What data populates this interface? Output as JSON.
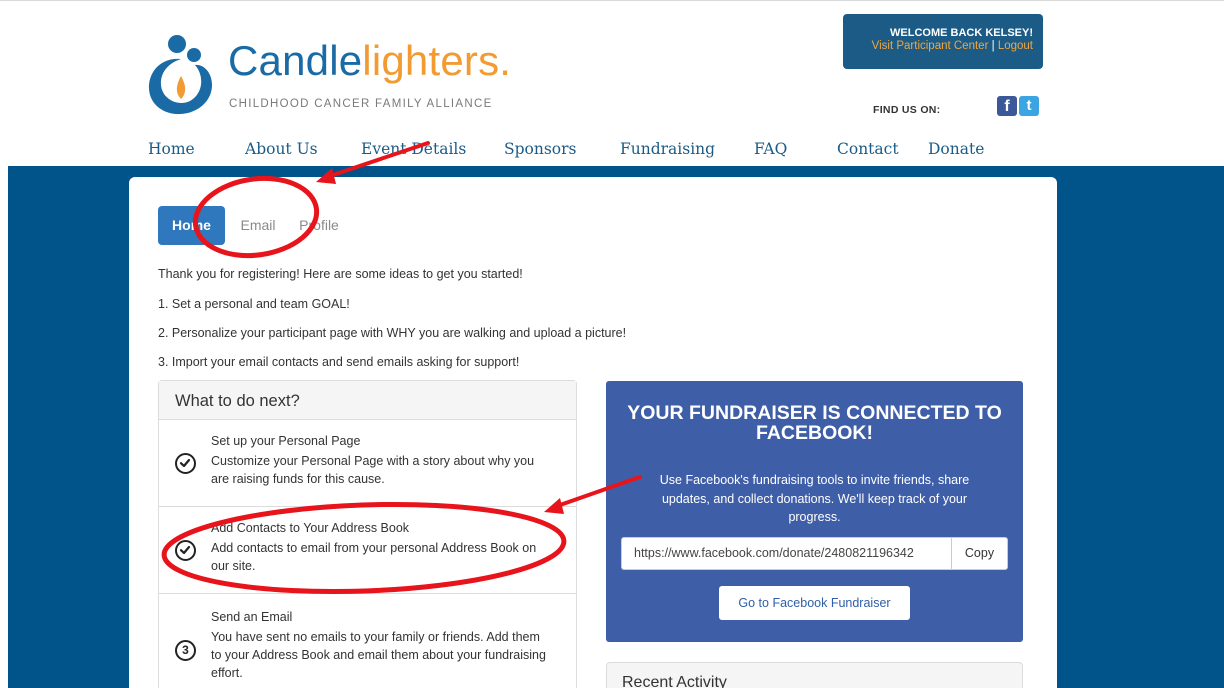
{
  "header": {
    "logo": {
      "word_part1": "Candle",
      "word_part2": "lighters",
      "tagline": "CHILDHOOD CANCER FAMILY ALLIANCE"
    },
    "welcome": {
      "title": "WELCOME BACK KELSEY!",
      "participant_center": "Visit Participant Center",
      "separator": "|",
      "logout": "Logout"
    },
    "find_us": "FIND US ON:",
    "social": {
      "facebook_glyph": "f",
      "twitter_glyph": "t"
    },
    "nav": [
      "Home",
      "About Us",
      "Event Details",
      "Sponsors",
      "Fundraising",
      "FAQ",
      "Contact",
      "Donate"
    ]
  },
  "tabs": [
    "Home",
    "Email",
    "Profile"
  ],
  "intro_lines": [
    "Thank you for registering! Here are some ideas to get you started!",
    "1. Set a personal and team GOAL!",
    "2. Personalize your participant page with WHY you are walking and upload a picture!",
    "3. Import your email contacts and send emails asking for support!"
  ],
  "todo": {
    "title": "What to do next?",
    "steps": [
      {
        "title": "Set up your Personal Page",
        "desc": "Customize your Personal Page with a story about why you are raising funds for this cause.",
        "icon": "check-circle-icon"
      },
      {
        "title": "Add Contacts to Your Address Book",
        "desc": "Add contacts to email from your personal Address Book on our site.",
        "icon": "check-circle-icon"
      },
      {
        "title": "Send an Email",
        "desc": "You have sent no emails to your family or friends. Add them to your Address Book and email them about your fundraising effort.",
        "icon_text": "3"
      }
    ]
  },
  "facebook": {
    "title": "YOUR FUNDRAISER IS CONNECTED TO FACEBOOK!",
    "desc": "Use Facebook's fundraising tools to invite friends, share updates, and collect donations. We'll keep track of your progress.",
    "url": "https://www.facebook.com/donate/2480821196342",
    "copy_label": "Copy",
    "go_label": "Go to Facebook Fundraiser"
  },
  "recent": {
    "title": "Recent Activity"
  },
  "colors": {
    "brand_blue": "#1b5b86",
    "band_blue": "#00548a",
    "brand_orange": "#f29b33",
    "tab_active": "#2f78bd",
    "facebook_panel": "#3f5ea8",
    "annotation_red": "#e8141b"
  }
}
